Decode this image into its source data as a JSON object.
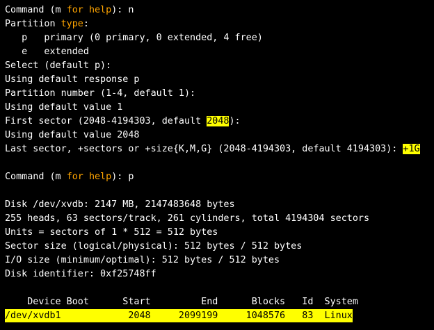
{
  "terminal": {
    "colors": {
      "background": "#000000",
      "text": "#ffffff",
      "keyword": "#ffa500",
      "highlight": "#ffff00"
    },
    "lines": [
      {
        "parts": [
          {
            "t": "Command (m "
          },
          {
            "t": "for",
            "s": "kw"
          },
          {
            "t": " "
          },
          {
            "t": "help",
            "s": "kw"
          },
          {
            "t": "): n"
          }
        ]
      },
      {
        "parts": [
          {
            "t": "Partition "
          },
          {
            "t": "type",
            "s": "kw"
          },
          {
            "t": ":"
          }
        ]
      },
      {
        "parts": [
          {
            "t": "   p   primary (0 primary, 0 extended, 4 free)"
          }
        ]
      },
      {
        "parts": [
          {
            "t": "   e   extended"
          }
        ]
      },
      {
        "parts": [
          {
            "t": "Select (default p):"
          }
        ]
      },
      {
        "parts": [
          {
            "t": "Using default response p"
          }
        ]
      },
      {
        "parts": [
          {
            "t": "Partition number (1-4, default 1):"
          }
        ]
      },
      {
        "parts": [
          {
            "t": "Using default value 1"
          }
        ]
      },
      {
        "parts": [
          {
            "t": "First sector (2048-4194303, default "
          },
          {
            "t": "2048",
            "s": "hl"
          },
          {
            "t": "):"
          }
        ]
      },
      {
        "parts": [
          {
            "t": "Using default value 2048"
          }
        ]
      },
      {
        "parts": [
          {
            "t": "Last sector, +sectors or +size{K,M,G} (2048-4194303, default 4194303): "
          },
          {
            "t": "+1G",
            "s": "hl"
          }
        ]
      },
      {
        "parts": []
      },
      {
        "parts": [
          {
            "t": "Command (m "
          },
          {
            "t": "for",
            "s": "kw"
          },
          {
            "t": " "
          },
          {
            "t": "help",
            "s": "kw"
          },
          {
            "t": "): p"
          }
        ]
      },
      {
        "parts": []
      },
      {
        "parts": [
          {
            "t": "Disk /dev/xvdb: 2147 MB, 2147483648 bytes"
          }
        ]
      },
      {
        "parts": [
          {
            "t": "255 heads, 63 sectors/track, 261 cylinders, total 4194304 sectors"
          }
        ]
      },
      {
        "parts": [
          {
            "t": "Units = sectors of 1 * 512 = 512 bytes"
          }
        ]
      },
      {
        "parts": [
          {
            "t": "Sector size (logical/physical): 512 bytes / 512 bytes"
          }
        ]
      },
      {
        "parts": [
          {
            "t": "I/O size (minimum/optimal): 512 bytes / 512 bytes"
          }
        ]
      },
      {
        "parts": [
          {
            "t": "Disk identifier: 0xf25748ff"
          }
        ]
      },
      {
        "parts": []
      },
      {
        "parts": [
          {
            "t": "    Device Boot      Start         End      Blocks   Id  System"
          }
        ]
      },
      {
        "parts": [
          {
            "t": "/dev/xvdb1            2048     2099199     1048576   83  Linux",
            "s": "row"
          }
        ]
      }
    ]
  }
}
